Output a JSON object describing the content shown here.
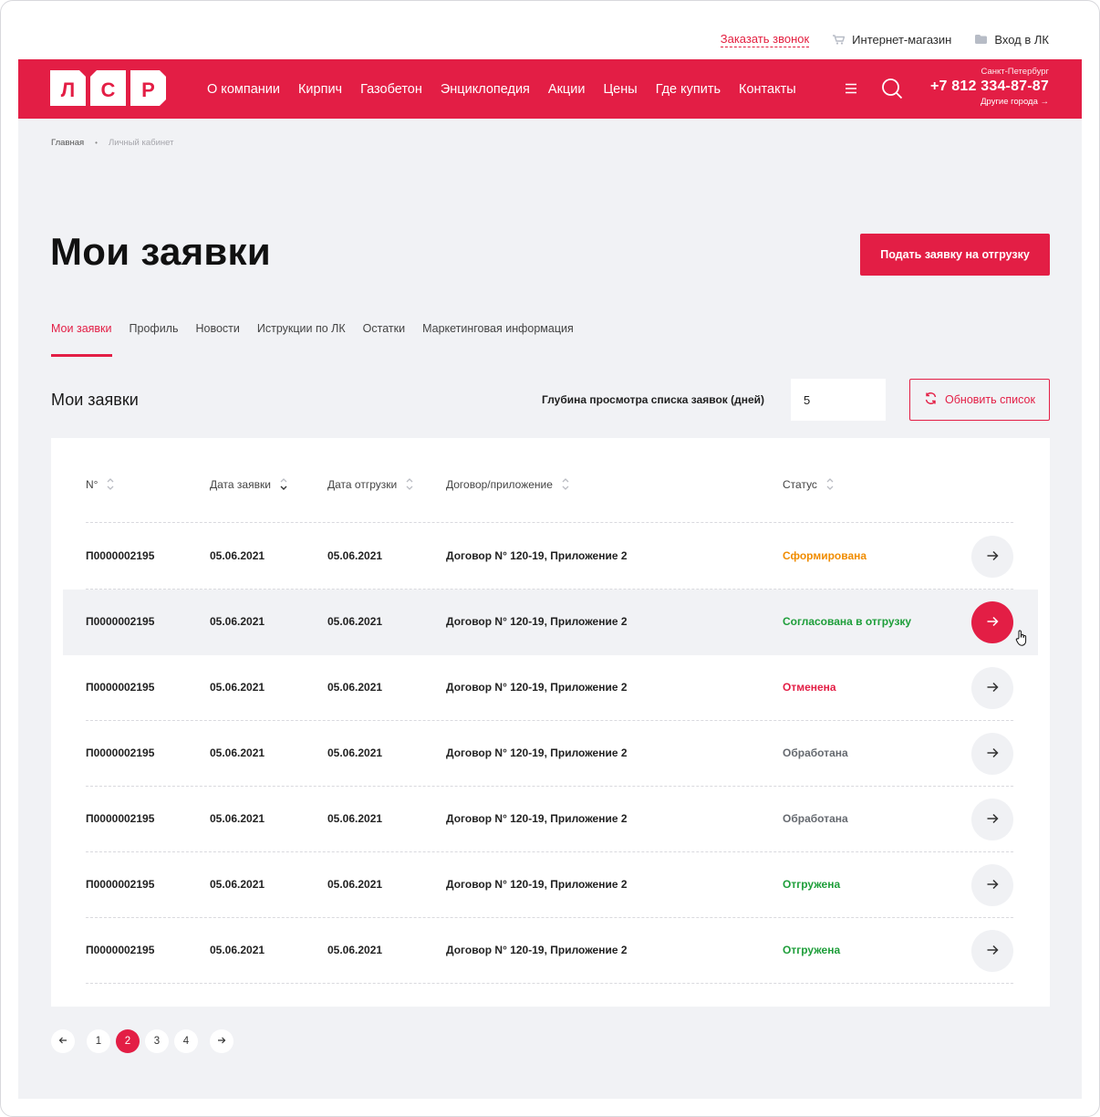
{
  "utility": {
    "callback": "Заказать звонок",
    "shop": "Интернет-магазин",
    "login": "Вход в ЛК"
  },
  "header": {
    "logo_letters": [
      "Л",
      "С",
      "Р"
    ],
    "nav": [
      "О компании",
      "Кирпич",
      "Газобетон",
      "Энциклопедия",
      "Акции",
      "Цены",
      "Где купить",
      "Контакты"
    ],
    "city": "Санкт-Петербург",
    "phone": "+7 812 334-87-87",
    "other_cities": "Другие города →"
  },
  "breadcrumb": {
    "home": "Главная",
    "separator": "•",
    "current": "Личный кабинет"
  },
  "page": {
    "title": "Мои заявки",
    "submit_button": "Подать заявку на отгрузку"
  },
  "tabs": [
    {
      "label": "Мои заявки",
      "active": true
    },
    {
      "label": "Профиль",
      "active": false
    },
    {
      "label": "Новости",
      "active": false
    },
    {
      "label": "Иструкции по ЛК",
      "active": false
    },
    {
      "label": "Остатки",
      "active": false
    },
    {
      "label": "Маркетинговая информация",
      "active": false
    }
  ],
  "orders_section": {
    "title": "Мои заявки",
    "depth_label": "Глубина просмотра списка заявок (дней)",
    "depth_value": "5",
    "refresh_button": "Обновить список"
  },
  "table": {
    "columns": [
      "N°",
      "Дата заявки",
      "Дата отгрузки",
      "Договор/приложение",
      "Статус"
    ],
    "rows": [
      {
        "number": "П0000002195",
        "order_date": "05.06.2021",
        "ship_date": "05.06.2021",
        "contract": "Договор N° 120-19, Приложение 2",
        "status": "Сформирована",
        "status_color": "#f08c00"
      },
      {
        "number": "П0000002195",
        "order_date": "05.06.2021",
        "ship_date": "05.06.2021",
        "contract": "Договор N° 120-19, Приложение 2",
        "status": "Согласована в отгрузку",
        "status_color": "#1e9e3a"
      },
      {
        "number": "П0000002195",
        "order_date": "05.06.2021",
        "ship_date": "05.06.2021",
        "contract": "Договор N° 120-19, Приложение 2",
        "status": "Отменена",
        "status_color": "#e31e45"
      },
      {
        "number": "П0000002195",
        "order_date": "05.06.2021",
        "ship_date": "05.06.2021",
        "contract": "Договор N° 120-19, Приложение 2",
        "status": "Обработана",
        "status_color": "#666a70"
      },
      {
        "number": "П0000002195",
        "order_date": "05.06.2021",
        "ship_date": "05.06.2021",
        "contract": "Договор N° 120-19, Приложение 2",
        "status": "Обработана",
        "status_color": "#666a70"
      },
      {
        "number": "П0000002195",
        "order_date": "05.06.2021",
        "ship_date": "05.06.2021",
        "contract": "Договор N° 120-19, Приложение 2",
        "status": "Отгружена",
        "status_color": "#1e9e3a"
      },
      {
        "number": "П0000002195",
        "order_date": "05.06.2021",
        "ship_date": "05.06.2021",
        "contract": "Договор N° 120-19, Приложение 2",
        "status": "Отгружена",
        "status_color": "#1e9e3a"
      }
    ]
  },
  "pagination": {
    "pages": [
      "1",
      "2",
      "3",
      "4"
    ],
    "current": "2"
  },
  "colors": {
    "brand": "#e31e45",
    "background": "#f1f2f5"
  }
}
